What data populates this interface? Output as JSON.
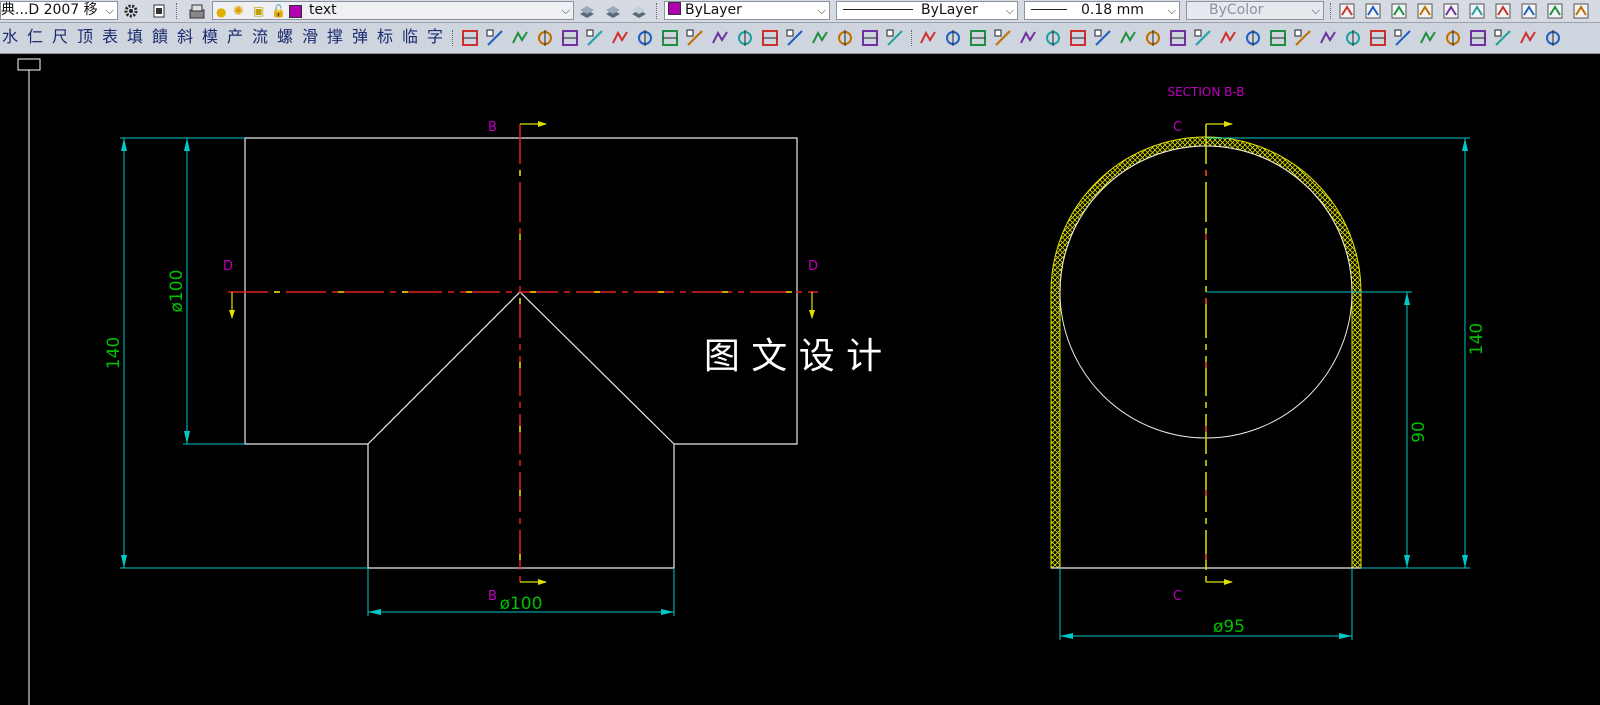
{
  "toolbar": {
    "style_dropdown": "典...D 2007 移",
    "layer_dropdown": "text",
    "color_dropdown": "ByLayer",
    "linetype_dropdown": "ByLayer",
    "lineweight_dropdown": "0.18 mm",
    "plotstyle_dropdown": "ByColor",
    "layer_color": "#b000b0",
    "color_swatch": "#b000b0"
  },
  "toolbar2": {
    "cjk_buttons": [
      "水",
      "仁",
      "尺",
      "顶",
      "表",
      "填",
      "饋",
      "斜",
      "模",
      "产",
      "流",
      "螺",
      "滑",
      "撑",
      "弹",
      "标",
      "临",
      "字"
    ],
    "icon_colors": [
      "#d03030",
      "#2060c0",
      "#209040",
      "#c07000",
      "#7030a0",
      "#20a0a0",
      "#d03030",
      "#2060c0",
      "#209040",
      "#c07000",
      "#7030a0",
      "#20a0a0",
      "#d03030",
      "#2060c0",
      "#209040",
      "#c07000",
      "#7030a0",
      "#20a0a0",
      "#d03030",
      "#2060c0",
      "#209040",
      "#c07000",
      "#7030a0",
      "#20a0a0",
      "#d03030",
      "#2060c0",
      "#209040",
      "#c07000",
      "#7030a0",
      "#20a0a0",
      "#d03030",
      "#2060c0",
      "#209040",
      "#c07000",
      "#7030a0",
      "#20a0a0",
      "#d03030",
      "#2060c0",
      "#209040",
      "#c07000",
      "#7030a0",
      "#20a0a0",
      "#d03030",
      "#2060c0"
    ]
  },
  "drawing": {
    "section_title": "SECTION B-B",
    "watermark": "图 文 设 计",
    "front_view": {
      "cut_b_top": "B",
      "cut_b_bottom": "B",
      "cut_d_left": "D",
      "cut_d_right": "D",
      "dim_total_height": "140",
      "dim_top_dia": "ø100",
      "dim_bottom_dia": "ø100"
    },
    "section_view": {
      "cut_c_top": "C",
      "cut_c_bottom": "C",
      "dim_height": "140",
      "dim_center_height": "90",
      "dim_width": "ø95"
    },
    "colors": {
      "outline": "#e8e8e8",
      "dimension": "#00c8c8",
      "dim_text": "#00c000",
      "label": "#c000c0",
      "centerline_red": "#e02020",
      "centerline_yellow": "#e0e000",
      "hatch": "#e0e000"
    }
  }
}
